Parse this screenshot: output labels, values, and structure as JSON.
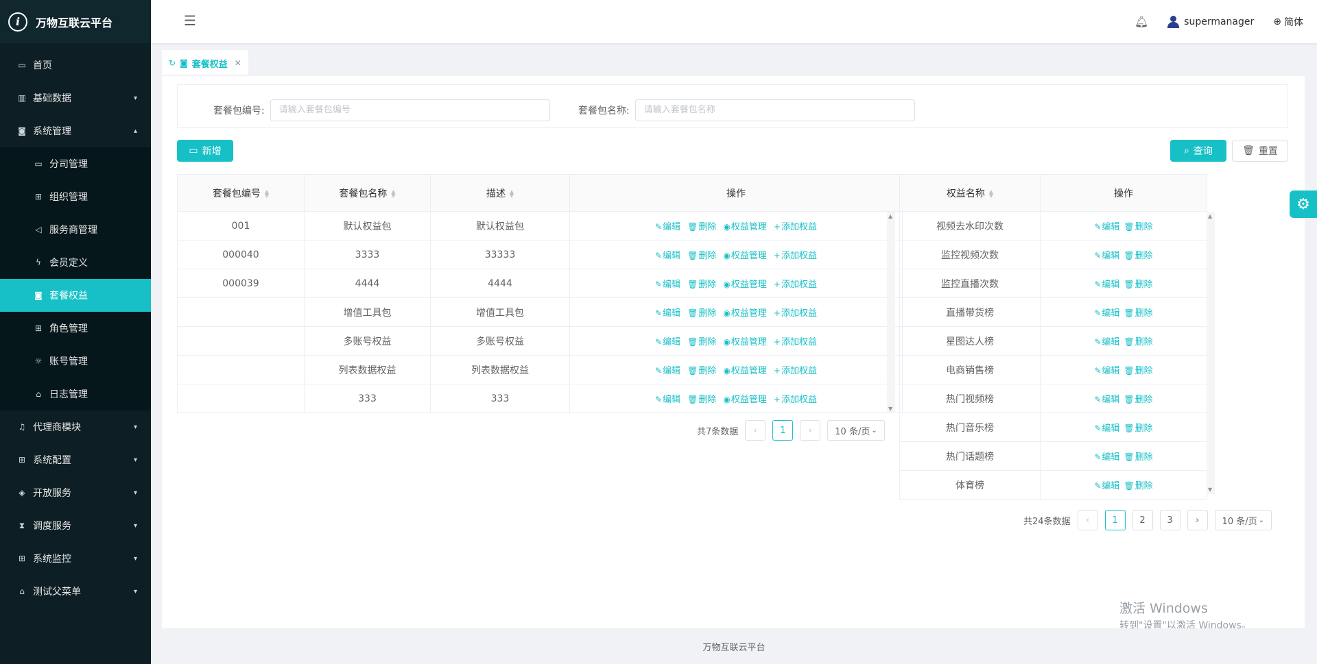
{
  "app": {
    "title": "万物互联云平台",
    "footer": "万物互联云平台"
  },
  "sidebar": {
    "home": "首页",
    "basic_data": "基础数据",
    "system_mgmt": "系统管理",
    "sub": [
      "分司管理",
      "组织管理",
      "服务商管理",
      "会员定义",
      "套餐权益",
      "角色管理",
      "账号管理",
      "日志管理"
    ],
    "agent": "代理商模块",
    "sys_config": "系统配置",
    "open_service": "开放服务",
    "schedule": "调度服务",
    "monitor": "系统监控",
    "test_menu": "测试父菜单"
  },
  "header": {
    "username": "supermanager",
    "language": "简体"
  },
  "tab": {
    "label": "套餐权益"
  },
  "search": {
    "code_label": "套餐包编号:",
    "code_placeholder": "请输入套餐包编号",
    "name_label": "套餐包名称:",
    "name_placeholder": "请输入套餐包名称"
  },
  "buttons": {
    "add": "新增",
    "query": "查询",
    "reset": "重置"
  },
  "left_table": {
    "headers": [
      "套餐包编号",
      "套餐包名称",
      "描述",
      "操作"
    ],
    "actions": [
      "编辑",
      "删除",
      "权益管理",
      "添加权益"
    ],
    "rows": [
      {
        "code": "001",
        "name": "默认权益包",
        "desc": "默认权益包"
      },
      {
        "code": "000040",
        "name": "3333",
        "desc": "33333"
      },
      {
        "code": "000039",
        "name": "4444",
        "desc": "4444"
      },
      {
        "code": "",
        "name": "增值工具包",
        "desc": "增值工具包"
      },
      {
        "code": "",
        "name": "多账号权益",
        "desc": "多账号权益"
      },
      {
        "code": "",
        "name": "列表数据权益",
        "desc": "列表数据权益"
      },
      {
        "code": "",
        "name": "333",
        "desc": "333"
      }
    ],
    "total": "共7条数据",
    "page": "1",
    "page_size": "10 条/页"
  },
  "right_table": {
    "headers": [
      "权益名称",
      "操作"
    ],
    "actions": [
      "编辑",
      "删除"
    ],
    "rows": [
      "视频去水印次数",
      "监控视频次数",
      "监控直播次数",
      "直播带货榜",
      "星图达人榜",
      "电商销售榜",
      "热门视频榜",
      "热门音乐榜",
      "热门话题榜",
      "体育榜"
    ],
    "total": "共24条数据",
    "pages": [
      "1",
      "2",
      "3"
    ],
    "page_size": "10 条/页"
  },
  "watermark": {
    "line1": "激活 Windows",
    "line2": "转到\"设置\"以激活 Windows。"
  },
  "colors": {
    "primary": "#17c0c7",
    "sidebar_bg": "#0d1f24"
  }
}
